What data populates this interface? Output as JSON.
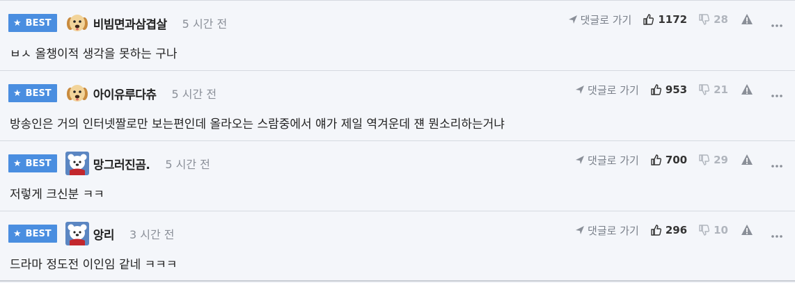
{
  "badge_label": "BEST",
  "reply_label": "댓글로 가기",
  "comments": [
    {
      "nick": "비빔면과삼겹살",
      "time": "5 시간 전",
      "likes": "1172",
      "dislikes": "28",
      "avatar_icon": "puppy-avatar-icon",
      "text": "ㅂㅅ 올챙이적 생각을 못하는 구나"
    },
    {
      "nick": "아이유루다츄",
      "time": "5 시간 전",
      "likes": "953",
      "dislikes": "21",
      "avatar_icon": "puppy-avatar-icon",
      "text": "방송인은 거의 인터넷짤로만 보는편인데 올라오는 스람중에서 얘가 제일 역겨운데 쟨 뭔소리하는거냐"
    },
    {
      "nick": "망그러진곰.",
      "time": "5 시간 전",
      "likes": "700",
      "dislikes": "29",
      "avatar_icon": "polar-bear-avatar-icon",
      "text": "저렇게 크신분 ㅋㅋ"
    },
    {
      "nick": "앙리",
      "time": "3 시간 전",
      "likes": "296",
      "dislikes": "10",
      "avatar_icon": "polar-bear-avatar-icon",
      "text": "드라마 정도전 이인임 같네 ㅋㅋㅋ"
    }
  ],
  "colors": {
    "badge": "#4a8ee0",
    "background": "#f4f6fa",
    "muted": "#8a8f98"
  }
}
